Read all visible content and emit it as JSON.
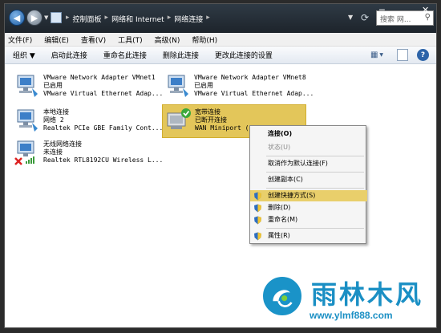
{
  "titlebar": {
    "breadcrumbs": [
      "控制面板",
      "网络和 Internet",
      "网络连接"
    ],
    "search_placeholder": "搜索 网...",
    "close_glyph": "✕",
    "minimize_glyph": "─"
  },
  "menu": {
    "items": [
      "文件(F)",
      "编辑(E)",
      "查看(V)",
      "工具(T)",
      "高级(N)",
      "帮助(H)"
    ]
  },
  "toolbar": {
    "items": [
      "组织 ▼",
      "启动此连接",
      "重命名此连接",
      "删除此连接",
      "更改此连接的设置"
    ]
  },
  "connections": [
    {
      "name": "VMware Network Adapter VMnet1",
      "status": "已启用",
      "device": "VMware Virtual Ethernet Adap..."
    },
    {
      "name": "VMware Network Adapter VMnet8",
      "status": "已启用",
      "device": "VMware Virtual Ethernet Adap..."
    },
    {
      "name": "本地连接",
      "status": "网络  2",
      "device": "Realtek PCIe GBE Family Cont..."
    },
    {
      "name": "宽带连接",
      "status": "已断开连接",
      "device": "WAN Miniport (PPPOE)"
    },
    {
      "name": "无线网络连接",
      "status": "未连接",
      "device": "Realtek RTL8192CU Wireless L..."
    }
  ],
  "context_menu": {
    "items": [
      "连接(O)",
      "状态(U)",
      "取消作为默认连接(F)",
      "创建副本(C)",
      "创建快捷方式(S)",
      "删除(D)",
      "重命名(M)",
      "属性(R)"
    ]
  },
  "watermark": {
    "title": "雨林木风",
    "url": "www.ylmf888.com"
  },
  "colors": {
    "selection": "#e3c65a",
    "highlight": "#e9cf6b",
    "titlebar": "#1d242b",
    "watermark": "#1a8fc4"
  }
}
